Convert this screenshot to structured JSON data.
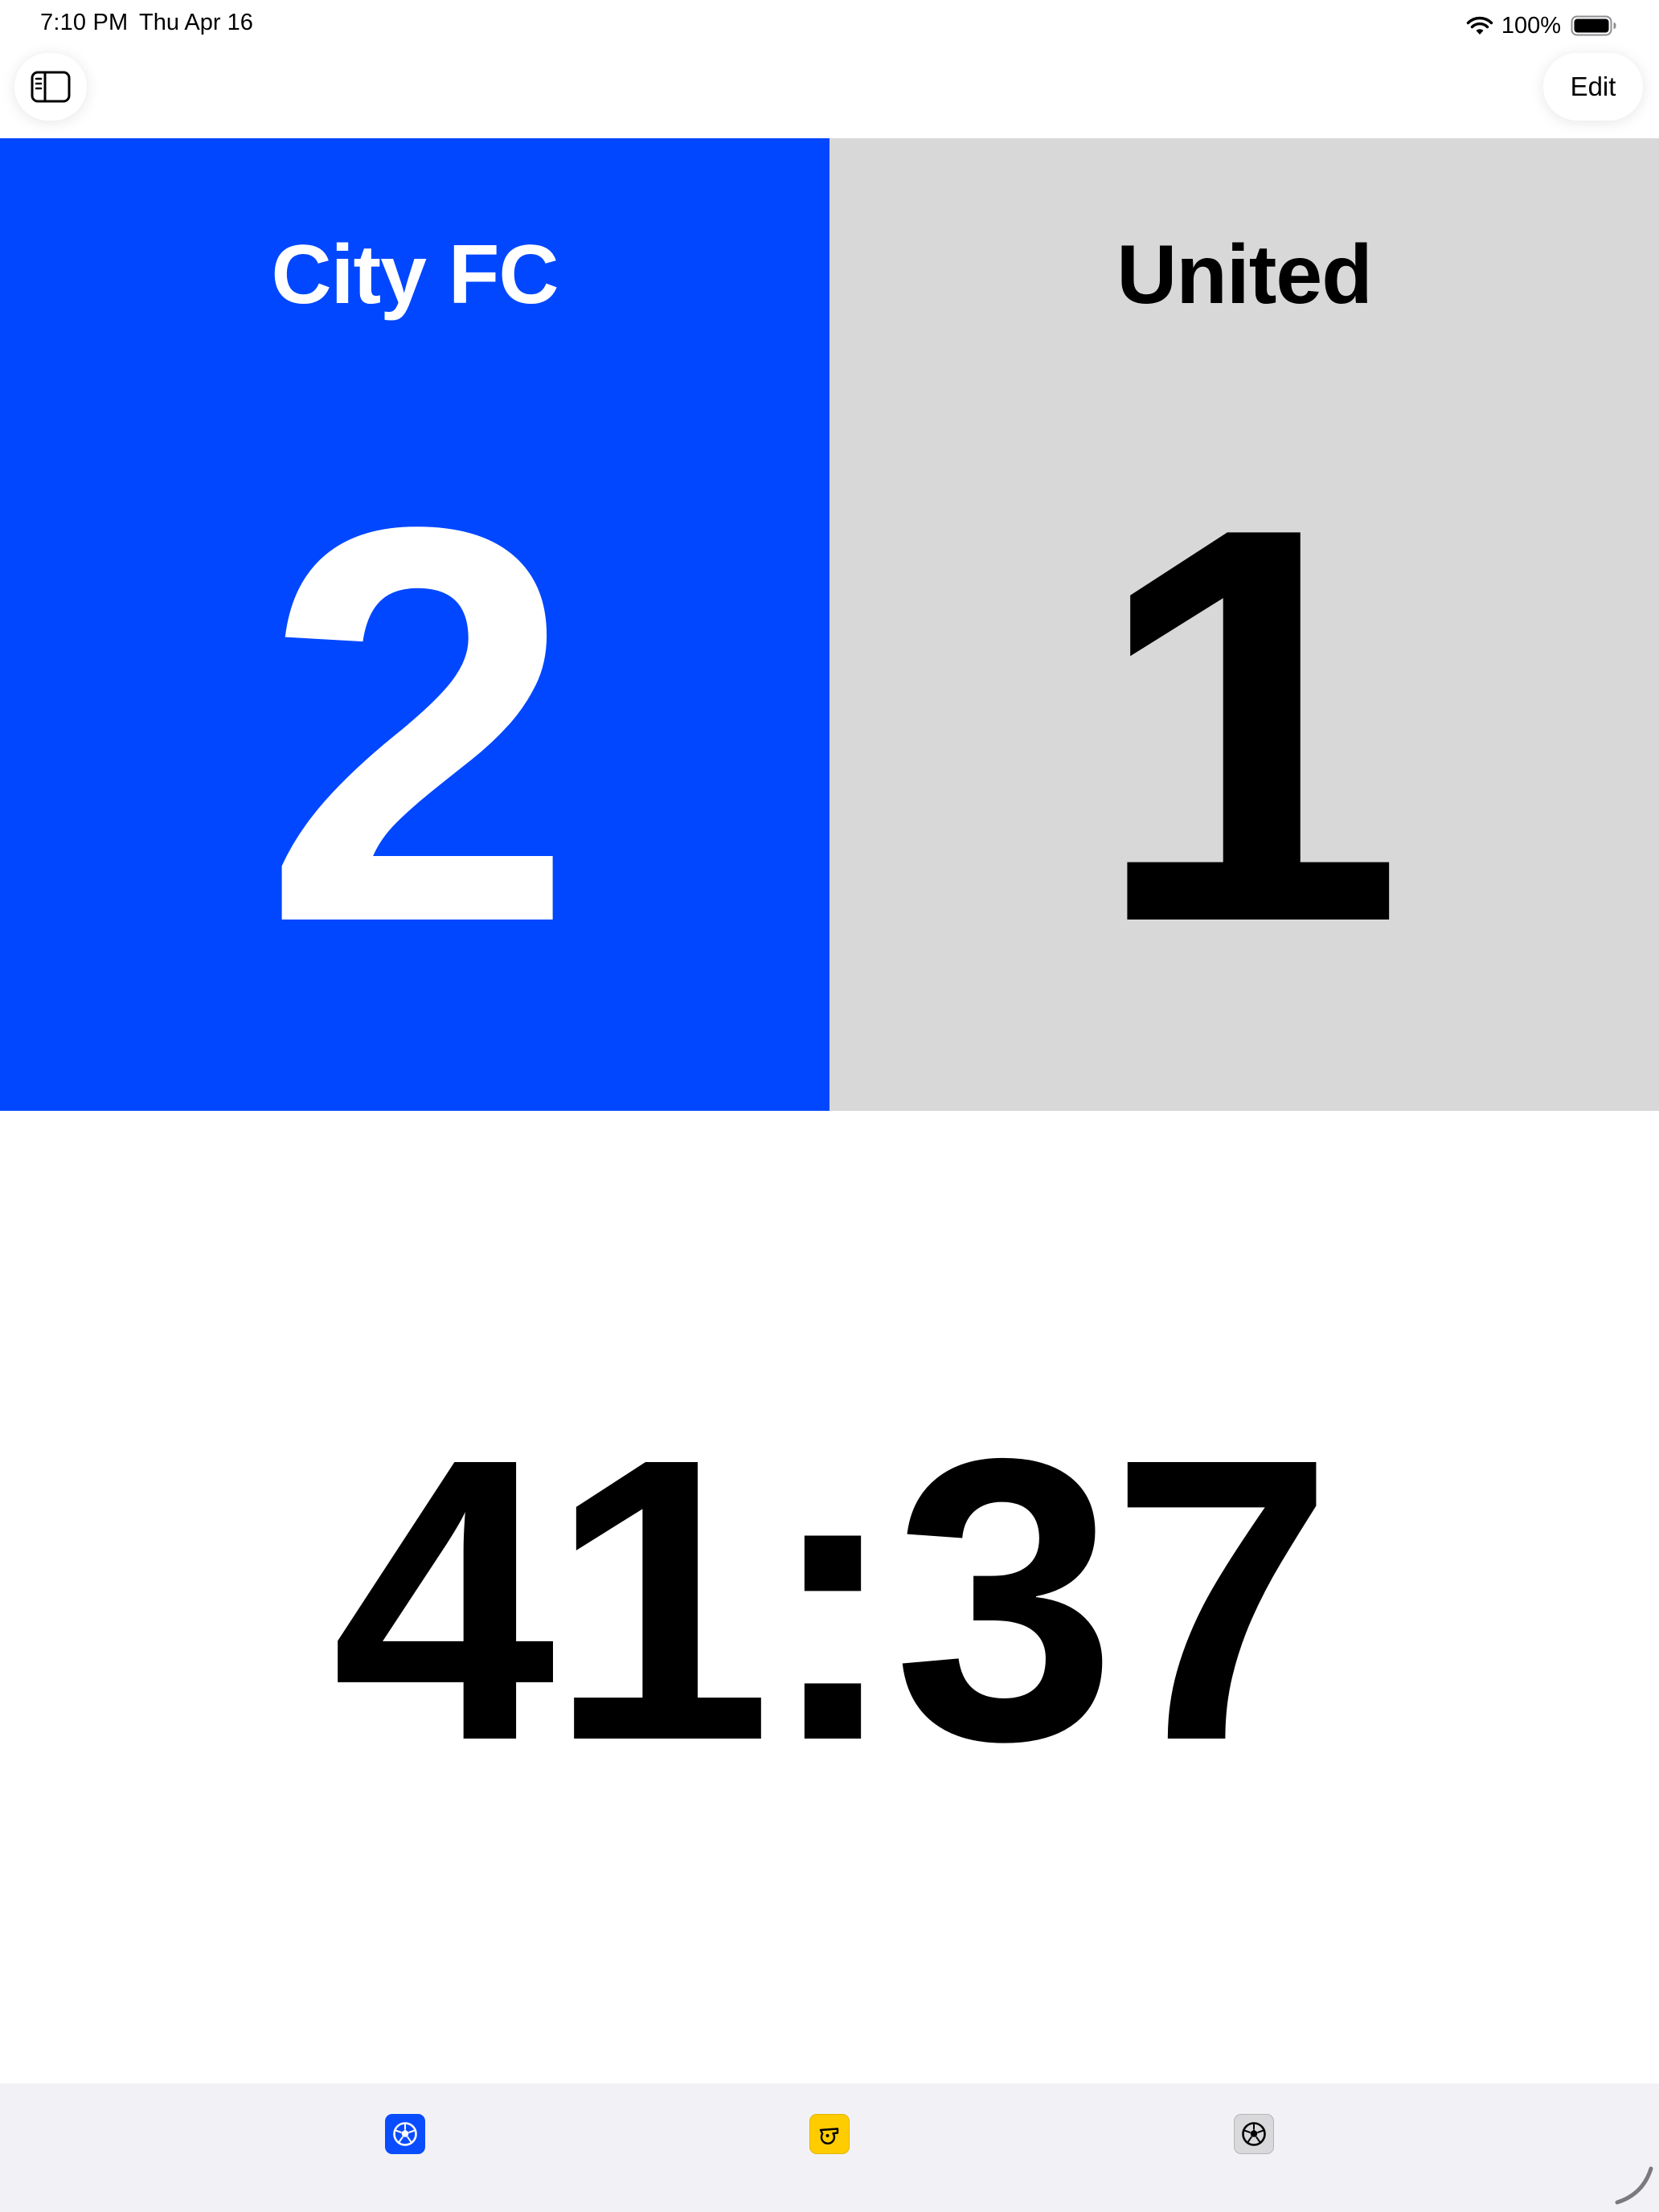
{
  "status_bar": {
    "time": "7:10 PM",
    "date": "Thu Apr 16",
    "battery_percent": "100%",
    "battery_level": 1.0
  },
  "nav": {
    "sidebar_icon": "sidebar-toggle-icon",
    "edit_label": "Edit"
  },
  "teams": {
    "home": {
      "name": "City FC",
      "score": "2",
      "color": "#0047ff"
    },
    "away": {
      "name": "United",
      "score": "1",
      "color": "#d8d8d8"
    }
  },
  "clock": {
    "display": "41:37"
  },
  "tabs": [
    {
      "icon": "soccer-ball-icon",
      "color": "#0a4dff",
      "selected": true
    },
    {
      "icon": "whistle-icon",
      "color": "#ffcc00",
      "selected": false
    },
    {
      "icon": "soccer-ball-icon",
      "color": "#d9d9dc",
      "selected": false
    }
  ]
}
